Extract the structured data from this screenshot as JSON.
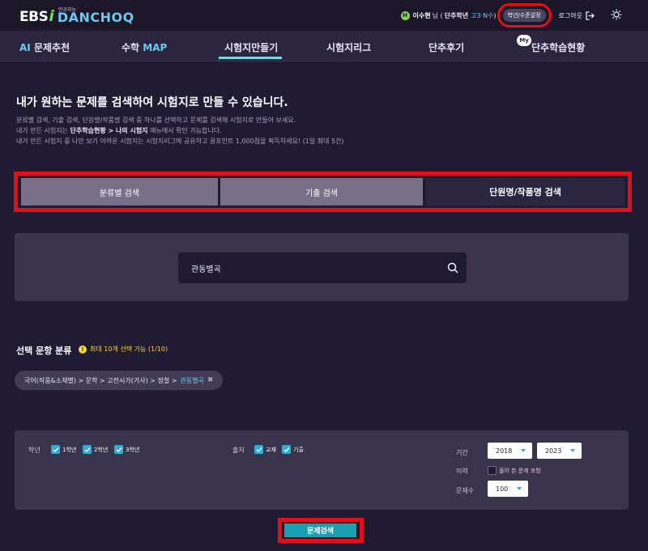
{
  "brand": {
    "ebs": "EBS",
    "i": "i",
    "sub": "인공지능",
    "name": "DANCHOQ"
  },
  "user": {
    "badge": "H",
    "name": "이수현",
    "suffix": "님 (",
    "grade_label": "단추학년",
    "grade_value": "고3·N수",
    "close": ")",
    "grade_button": "학년/수준설정",
    "logout": "로그아웃"
  },
  "nav": {
    "items": [
      {
        "prefix": "AI",
        "label": " 문제추천"
      },
      {
        "prefix": "수학 ",
        "label": "MAP"
      },
      {
        "label": "시험지만들기"
      },
      {
        "label": "시험지리그"
      },
      {
        "label": "단추후기"
      },
      {
        "badge": "My",
        "label": "단추학습현황"
      }
    ]
  },
  "intro": {
    "title": "내가 원하는 문제를 검색하여 시험지로 만들 수 있습니다.",
    "line1": "분류별 검색, 기출 검색, 단원명/작품명 검색 중 하나를 선택하고 문제를 검색해 시험지로 만들어 보세요.",
    "line2_pre": "내가 만든 시험지는 ",
    "line2_bold": "단추학습현황 > 나의 시험지",
    "line2_post": " 메뉴에서 확인 가능합니다.",
    "line3": "내가 만든 시험지 중 나만 보기 아까운 시험지는 시험지리그에 공유하고 꿈포인트 1,000점을 획득하세요! (1일 최대 5건)"
  },
  "tabs": [
    {
      "label": "분류별 검색"
    },
    {
      "label": "기출 검색"
    },
    {
      "label": "단원명/작품명 검색"
    }
  ],
  "search": {
    "value": "관동별곡"
  },
  "selection": {
    "title": "선택 문항 분류",
    "note": "최대 10개 선택 가능 (1/10)",
    "chip_path": "국어(작품&소재별) > 문학 > 고전시가(가사) > 정철 >",
    "chip_leaf": "관동별곡"
  },
  "filters": {
    "grade_label": "학년",
    "grades": [
      "1학년",
      "2학년",
      "3학년"
    ],
    "source_label": "출처",
    "sources": [
      "교재",
      "기출"
    ],
    "period_label": "기간",
    "year_from": "2018",
    "year_to": "2023",
    "history_label": "이력",
    "history_option": "풀어 본 문제 포함",
    "count_label": "문제수",
    "count_value": "100"
  },
  "search_button": "문제검색",
  "colors": {
    "accent": "#1aa0b0",
    "highlight": "#e0101a",
    "check": "#35a9d9"
  }
}
